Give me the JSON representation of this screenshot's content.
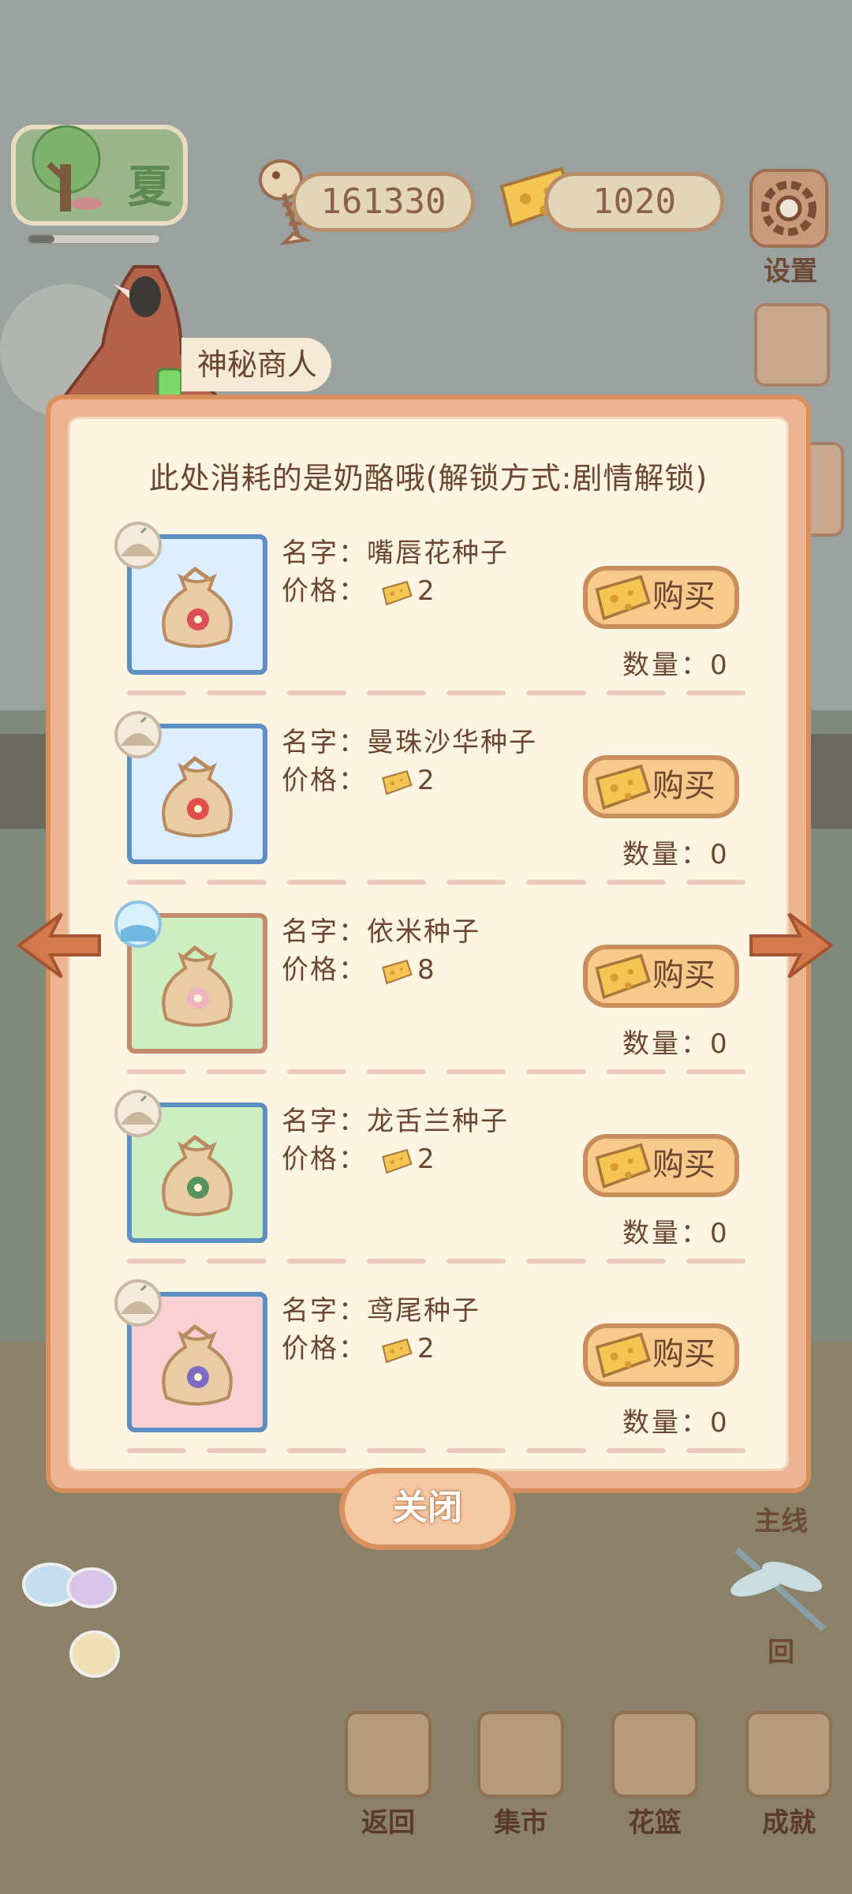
{
  "hud": {
    "season": "夏",
    "season_progress": 0.2,
    "fish_count": "161330",
    "cheese_count": "1020",
    "settings_label": "设置"
  },
  "merchant": {
    "name": "神秘商人"
  },
  "shop": {
    "notice": "此处消耗的是奶酪哦(解锁方式:剧情解锁)",
    "name_prefix": "名字：",
    "price_prefix": "价格：",
    "qty_prefix": "数量：",
    "buy_label": "购买",
    "items": [
      {
        "name": "嘴唇花种子",
        "price": "2",
        "qty": "0",
        "bg": "blue",
        "flower_color": "#d93a4a"
      },
      {
        "name": "曼珠沙华种子",
        "price": "2",
        "qty": "0",
        "bg": "blue",
        "flower_color": "#e03a3a"
      },
      {
        "name": "依米种子",
        "price": "8",
        "qty": "0",
        "bg": "green",
        "flower_color": "#f1b0c4"
      },
      {
        "name": "龙舌兰种子",
        "price": "2",
        "qty": "0",
        "bg": "green",
        "flower_color": "#3d8a52"
      },
      {
        "name": "鸢尾种子",
        "price": "2",
        "qty": "0",
        "bg": "pink",
        "flower_color": "#6a5bc9"
      }
    ],
    "close_label": "关闭"
  },
  "side": {
    "main_line_label": "主线",
    "back_home_label": "回"
  },
  "nav": {
    "back": "返回",
    "market": "集市",
    "basket": "花篮",
    "achievement": "成就"
  }
}
